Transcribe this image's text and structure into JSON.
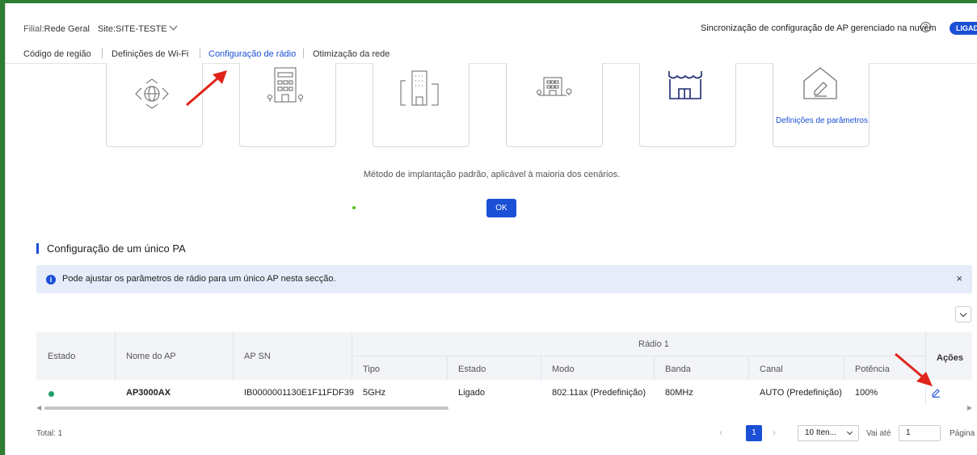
{
  "header": {
    "branch_label": "Filial:",
    "branch_value": "Rede Geral",
    "site_label": "Site:",
    "site_value": "SITE-TESTE",
    "sync_text": "Sincronização de configuração de AP gerenciado na nuvem",
    "help_glyph": "?",
    "sync_toggle": "LIGADO"
  },
  "tabs": [
    {
      "label": "Código de região"
    },
    {
      "label": "Definições de Wi-Fi"
    },
    {
      "label": "Configuração de rádio",
      "active": true
    },
    {
      "label": "Otimização da rede"
    }
  ],
  "scenarios": {
    "last_card_label": "Definições de parâmetros"
  },
  "scenario_desc": "Método de implantação padrão, aplicável à maioria dos cenários.",
  "ok_label": "OK",
  "section_title": "Configuração de um único PA",
  "alert": {
    "info_glyph": "i",
    "message": "Pode ajustar os parâmetros de rádio para um único AP nesta secção.",
    "close_glyph": "×"
  },
  "table": {
    "headers": {
      "estado": "Estado",
      "nome": "Nome do AP",
      "sn": "AP SN",
      "radio_group": "Rádio 1",
      "tipo": "Tipo",
      "radio_estado": "Estado",
      "modo": "Modo",
      "banda": "Banda",
      "canal": "Canal",
      "potencia": "Potência",
      "acoes": "Ações"
    },
    "rows": [
      {
        "nome": "AP3000AX",
        "sn": "IB0000001130E1F11FDF39",
        "tipo": "5GHz",
        "estado": "Ligado",
        "modo": "802.11ax (Predefinição)",
        "banda": "80MHz",
        "canal": "AUTO (Predefinição)",
        "potencia": "100%"
      }
    ]
  },
  "pagination": {
    "total": "Total: 1",
    "prev_glyph": "‹",
    "current_page": "1",
    "next_glyph": "›",
    "page_size": "10 Iten...",
    "goto_label": "Vai até",
    "goto_value": "1",
    "page_label": "Página"
  },
  "colors": {
    "accent": "#1a4fd6",
    "status_online": "#1a9e6a",
    "annotation_arrow": "#e0241b"
  }
}
